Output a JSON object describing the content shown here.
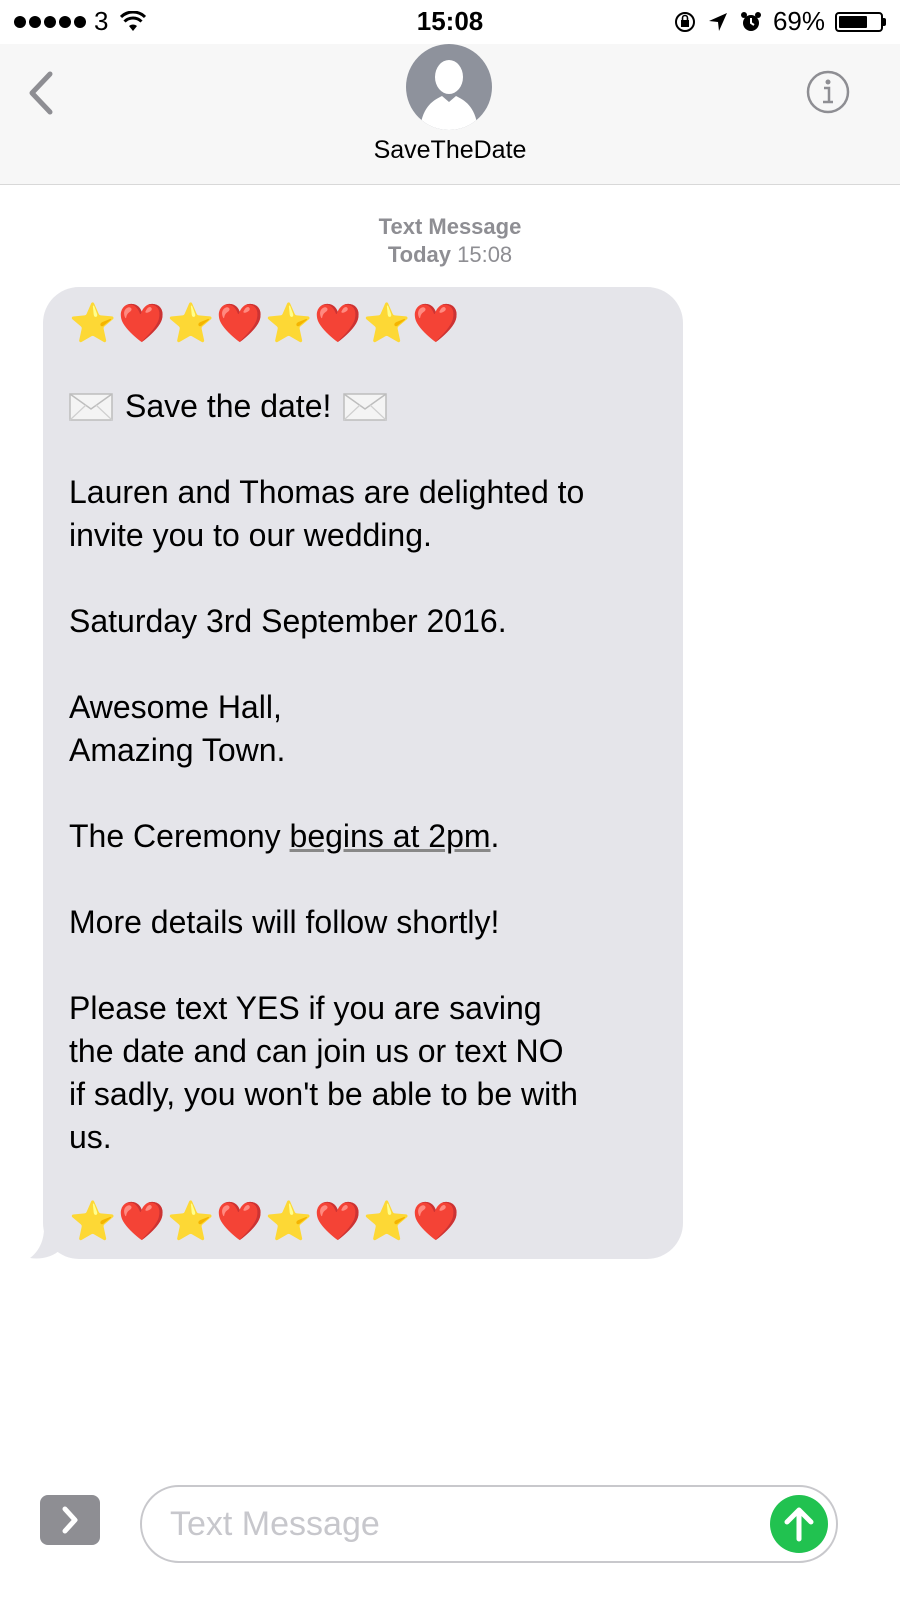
{
  "status_bar": {
    "carrier": "3",
    "time": "15:08",
    "battery_percent_label": "69%",
    "battery_level": 0.69
  },
  "header": {
    "contact_name": "SaveTheDate"
  },
  "conversation": {
    "service_label": "Text Message",
    "day_label": "Today",
    "time_label": "15:08"
  },
  "message": {
    "emoji_top": [
      "⭐",
      "❤️",
      "⭐",
      "❤️",
      "⭐",
      "❤️",
      "⭐",
      "❤️"
    ],
    "subject": "Save the date!",
    "p1": "Lauren and Thomas are delighted to\ninvite you to our wedding.",
    "p2": "Saturday 3rd September 2016.",
    "p3": "Awesome Hall,\nAmazing Town.",
    "p4_before": "The Ceremony ",
    "p4_link": "begins at 2pm",
    "p4_after": ".",
    "p5": "More details will follow shortly!",
    "p6": "Please text YES if you are saving\nthe date and can join us or text NO\nif sadly, you won't be able to be with\nus.",
    "emoji_bottom": [
      "⭐",
      "❤️",
      "⭐",
      "❤️",
      "⭐",
      "❤️",
      "⭐",
      "❤️"
    ]
  },
  "composer": {
    "placeholder": "Text Message"
  },
  "colors": {
    "bubble": "#e5e5ea",
    "send": "#21c250",
    "avatar": "#8e929c",
    "meta_text": "#8e8e93"
  }
}
